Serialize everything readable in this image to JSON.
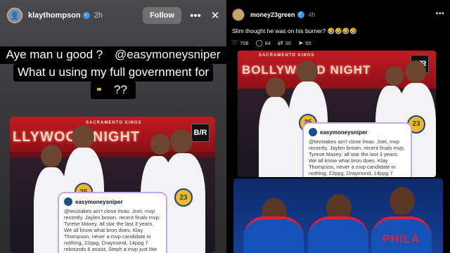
{
  "story": {
    "username": "klaythompson",
    "time": "2h",
    "follow_label": "Follow",
    "more_icon": "more-horizontal-icon",
    "close_icon": "close-icon",
    "caption": {
      "line1_pre": "Aye man u good ? ",
      "line1_mention": "@easymoneysniper",
      "line2": "What u using my full government for",
      "line3_tail": "??"
    },
    "photo": {
      "sign_top": "SACRAMENTO KINGS",
      "sign_main": "LLYWOOD NIGHT",
      "badge": "B/R",
      "jersey_numbers": [
        "35",
        "23"
      ]
    }
  },
  "tweet": {
    "user": "easymoneysniper",
    "body": "@tevstakes ain't close lmao. Joel, mvp recently. Jaylen brown, recent finals mvp, Tyrese Maxey, all star the last 3 years. We all know what bron does. Klay Thompson, never a mvp candidate in nothing, 22ppg. Draymond, 14ppg 7 rebounds 6 assist, Steph a mvp just like Joel was. I don't get how the warriors team is better on paper"
  },
  "post": {
    "username": "money23green",
    "time": "4h",
    "text": "Slim thought he was on his burner? 🤣🤣🤣🤣",
    "actions": {
      "likes": "708",
      "replies": "84",
      "reposts": "30",
      "shares": "65"
    },
    "photo": {
      "sign_top": "SACRAMENTO KINGS",
      "sign_main": "BOLLYWOOD NIGHT",
      "badge": "B/R",
      "jersey_numbers": [
        "35",
        "23"
      ],
      "team_text": "PHILA"
    }
  }
}
